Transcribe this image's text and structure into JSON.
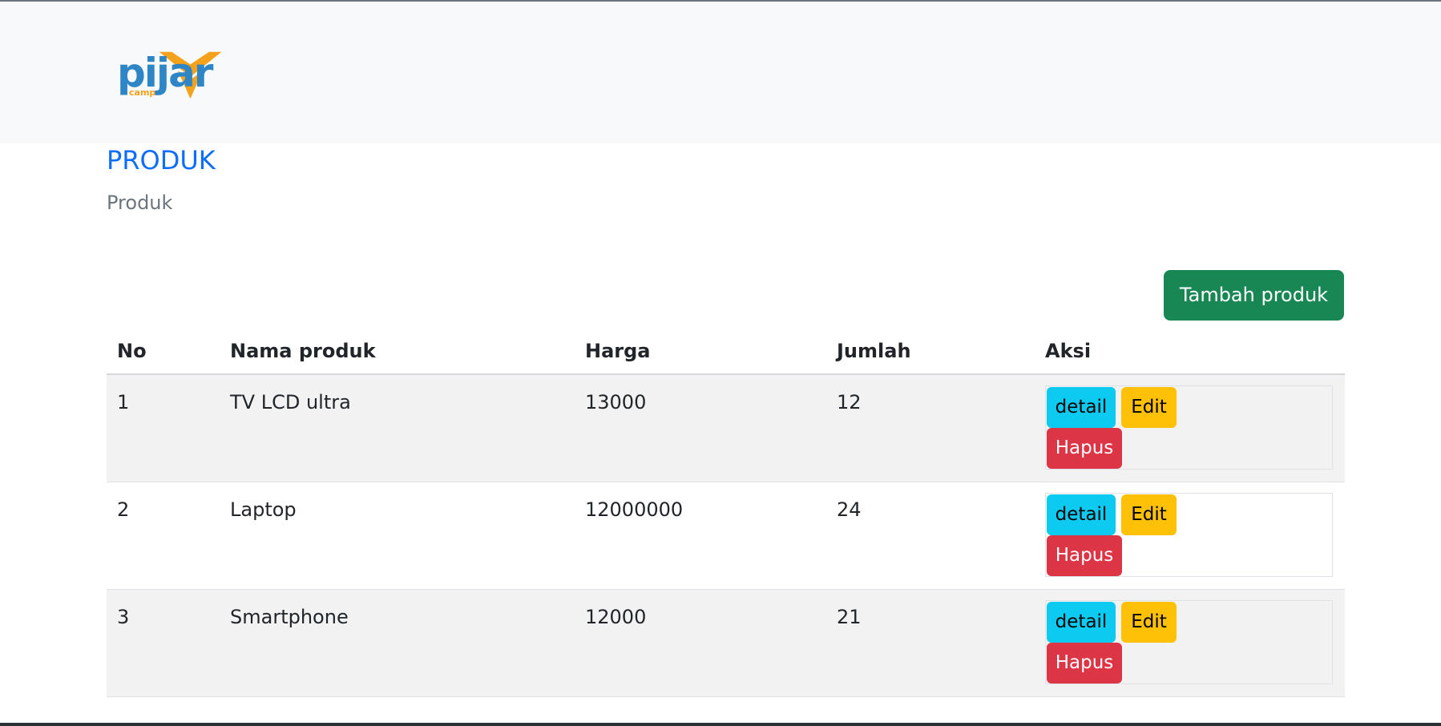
{
  "brand": {
    "logo_text": "pijar",
    "logo_sub": "camp"
  },
  "page": {
    "title": "PRODUK",
    "subtitle": "Produk"
  },
  "actions": {
    "add_label": "Tambah produk"
  },
  "table": {
    "headers": {
      "no": "No",
      "name": "Nama produk",
      "price": "Harga",
      "qty": "Jumlah",
      "action": "Aksi"
    },
    "rows": [
      {
        "no": "1",
        "name": "TV LCD ultra",
        "price": "13000",
        "qty": "12",
        "detail": "detail",
        "edit": "Edit",
        "delete": "Hapus"
      },
      {
        "no": "2",
        "name": "Laptop",
        "price": "12000000",
        "qty": "24",
        "detail": "detail",
        "edit": "Edit",
        "delete": "Hapus"
      },
      {
        "no": "3",
        "name": "Smartphone",
        "price": "12000",
        "qty": "21",
        "detail": "detail",
        "edit": "Edit",
        "delete": "Hapus"
      }
    ]
  },
  "colors": {
    "brand_blue": "#2f86c7",
    "brand_orange": "#f4a11c",
    "title_blue": "#0d6efd",
    "success": "#198754",
    "info": "#0dcaf0",
    "warning": "#ffc107",
    "danger": "#dc3545"
  },
  "icons": {
    "logo_mark": "flame-icon"
  }
}
